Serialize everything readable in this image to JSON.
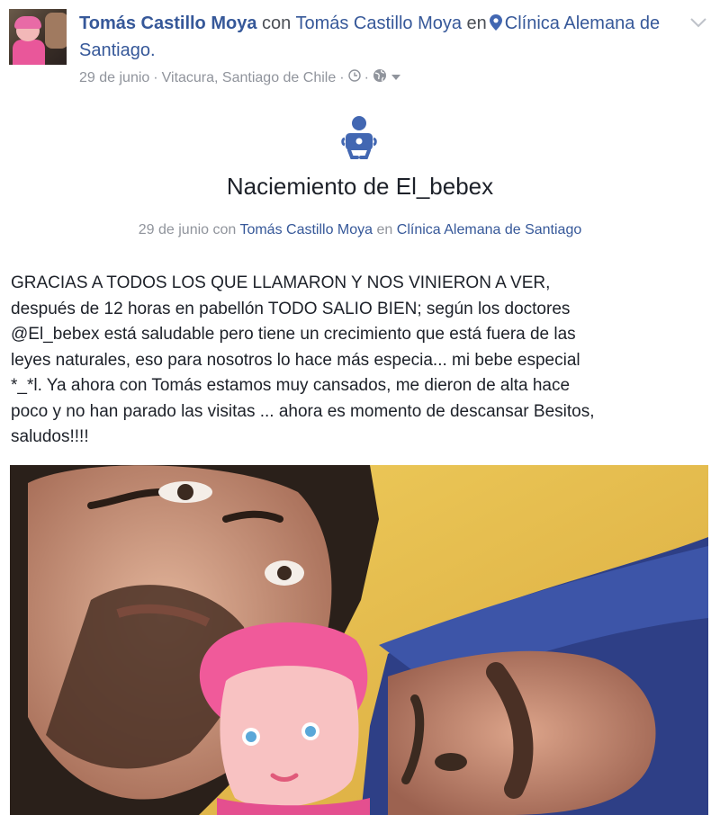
{
  "post": {
    "author": "Tomás Castillo Moya",
    "with_word": "con",
    "tagged": "Tomás Castillo Moya",
    "in_word": "en",
    "place": "Clínica Alemana de Santiago.",
    "date": "29 de junio",
    "location": "Vitacura, Santiago de Chile",
    "separator": "·"
  },
  "event": {
    "title": "Naciemiento de El_bebex",
    "date": "29 de junio",
    "with_word": "con",
    "with_person": "Tomás Castillo Moya",
    "in_word": "en",
    "place": "Clínica Alemana de Santiago"
  },
  "body": {
    "text": "GRACIAS A TODOS LOS QUE LLAMARON Y NOS VINIERON A VER,\ndespués de 12 horas en pabellón TODO SALIO BIEN; según los doctores\n@El_bebex está saludable pero tiene un crecimiento que está fuera de las\nleyes naturales, eso para nosotros lo hace más especia... mi bebe especial\n*_*l. Ya ahora con Tomás estamos muy cansados, me dieron de alta hace\npoco y no han parado las visitas ... ahora es momento de descansar Besitos,\nsaludos!!!!"
  },
  "icons": {
    "location": "location-pin-icon",
    "clock": "clock-icon",
    "globe": "globe-icon",
    "caret": "caret-down-icon",
    "options": "chevron-down-icon",
    "event": "baby-icon"
  },
  "colors": {
    "link": "#365899",
    "meta": "#90949c",
    "text": "#1d2129"
  }
}
